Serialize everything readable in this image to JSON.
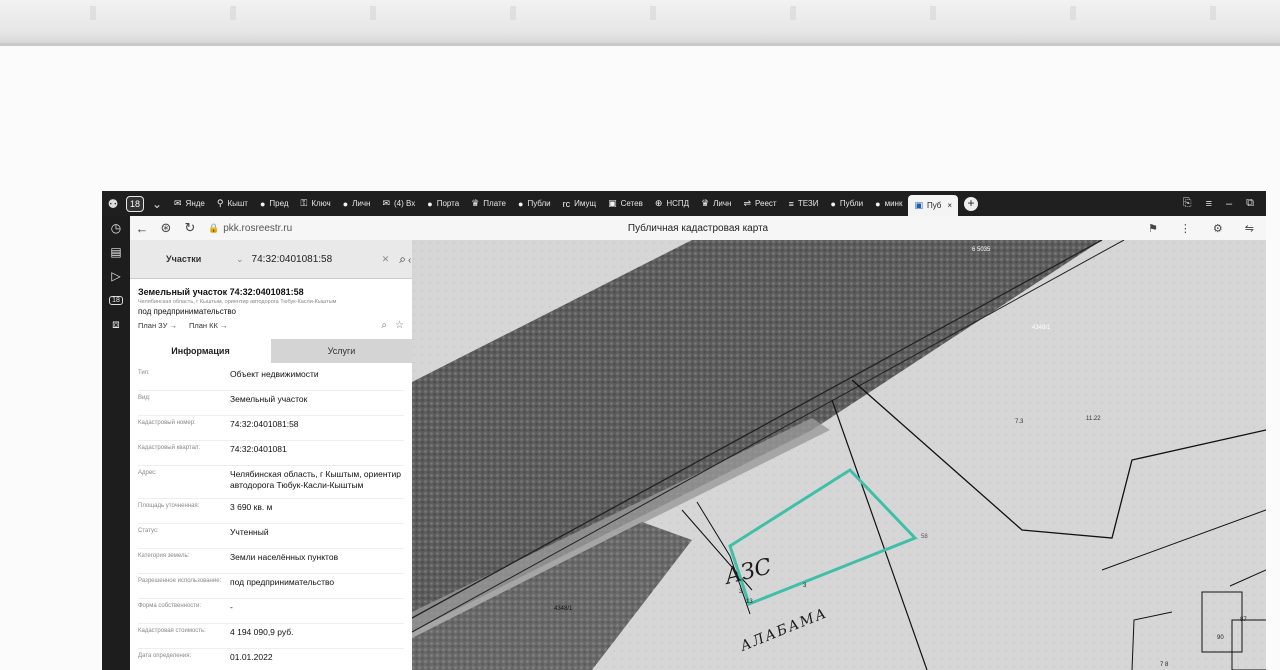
{
  "browser": {
    "pinned_tab_count": "18",
    "tabs": [
      {
        "icon": "✉",
        "label": "Янде"
      },
      {
        "icon": "⚲",
        "label": "Кышт"
      },
      {
        "icon": "●",
        "label": "Пред"
      },
      {
        "icon": "⚿",
        "label": "Ключ"
      },
      {
        "icon": "●",
        "label": "Личн"
      },
      {
        "icon": "✉",
        "label": "(4) Вх"
      },
      {
        "icon": "●",
        "label": "Порта"
      },
      {
        "icon": "♛",
        "label": "Плате"
      },
      {
        "icon": "●",
        "label": "Публи"
      },
      {
        "icon": "rc",
        "label": "Имущ"
      },
      {
        "icon": "▣",
        "label": "Сетев"
      },
      {
        "icon": "⊕",
        "label": "НСПД"
      },
      {
        "icon": "♛",
        "label": "Личн"
      },
      {
        "icon": "⇌",
        "label": "Реест"
      },
      {
        "icon": "≡",
        "label": "ТЕЗИ"
      },
      {
        "icon": "●",
        "label": "Публи"
      },
      {
        "icon": "●",
        "label": "минк"
      },
      {
        "icon": "▣",
        "label": "Пуб",
        "active": true
      }
    ],
    "url": "pkk.rosreestr.ru",
    "page_title": "Публичная кадастровая карта"
  },
  "search": {
    "category": "Участки",
    "query": "74:32:0401081:58"
  },
  "object": {
    "title": "Земельный участок 74:32:0401081:58",
    "address_line": "Челябинская область, г Кыштым, ориентир автодорога Тюбук-Касли-Кыштым",
    "use": "под предпринимательство",
    "link_zu": "План ЗУ →",
    "link_kk": "План КК →"
  },
  "tabs": {
    "info": "Информация",
    "services": "Услуги"
  },
  "rows": [
    {
      "key": "Тип:",
      "value": "Объект недвижимости"
    },
    {
      "key": "Вид:",
      "value": "Земельный участок"
    },
    {
      "key": "Кадастровый номер:",
      "value": "74:32:0401081:58"
    },
    {
      "key": "Кадастровый квартал:",
      "value": "74:32:0401081"
    },
    {
      "key": "Адрес:",
      "value": "Челябинская область, г Кыштым, ориентир автодорога Тюбук-Касли-Кыштым"
    },
    {
      "key": "Площадь уточненная:",
      "value": "3 690 кв. м"
    },
    {
      "key": "Статус:",
      "value": "Учтенный"
    },
    {
      "key": "Категория земель:",
      "value": "Земли населённых пунктов"
    },
    {
      "key": "Разрешенное использование:",
      "value": "под предпринимательство"
    },
    {
      "key": "Форма собственности:",
      "value": "-"
    },
    {
      "key": "Кадастровая стоимость:",
      "value": "4 194 090,9 руб."
    },
    {
      "key": "Дата определения:",
      "value": "01.01.2022"
    }
  ],
  "map": {
    "labels": {
      "road_top": "4348/1",
      "road_bottom": "4348/1",
      "top": "6 5035",
      "p73": "7.3",
      "p1122": "11.22",
      "p58": "58",
      "p3a": "3",
      "p13": "13",
      "p3b": "3",
      "p87": "87",
      "p90": "90",
      "p78": "7 8"
    },
    "handwriting_1": "АЗС",
    "handwriting_2": "АЛАБАМА",
    "highlight_color": "#3fbfa8"
  }
}
